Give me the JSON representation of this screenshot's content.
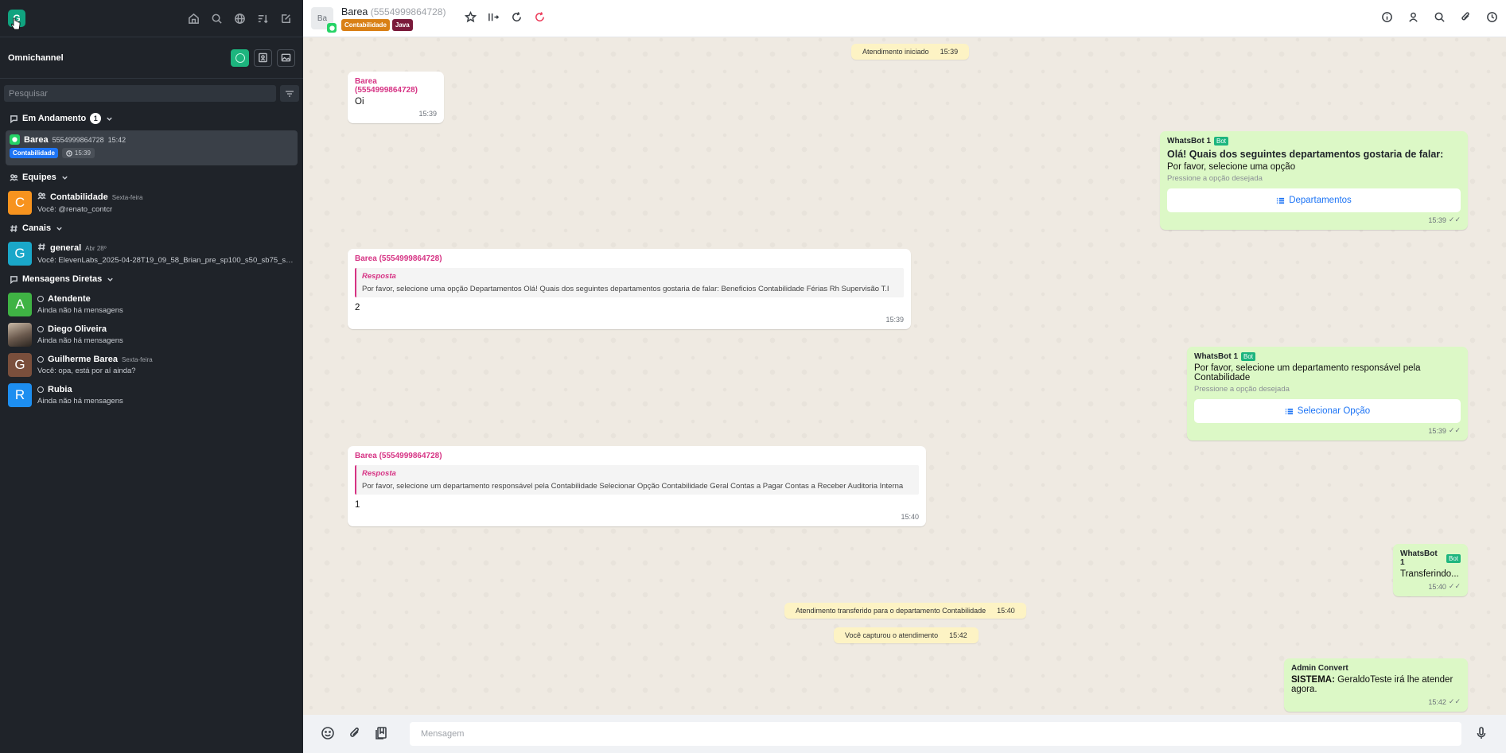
{
  "sidebar": {
    "me_initial": "G",
    "omnichannel_title": "Omnichannel",
    "search_placeholder": "Pesquisar",
    "in_progress": {
      "label": "Em Andamento",
      "count": "1",
      "conversation": {
        "name": "Barea",
        "phone": "5554999864728",
        "time": "15:42",
        "tag": "Contabilidade",
        "wait_time": "15:39"
      }
    },
    "teams": {
      "label": "Equipes",
      "items": [
        {
          "initial": "C",
          "color": "#f7931e",
          "name": "Contabilidade",
          "date": "Sexta-feira",
          "last": "Você: @renato_contcr"
        }
      ]
    },
    "channels": {
      "label": "Canais",
      "items": [
        {
          "initial": "G",
          "color": "#1aa7c9",
          "name": "general",
          "date": "Abr 28º",
          "last": "Você: ElevenLabs_2025-04-28T19_09_58_Brian_pre_sp100_s50_sb75_se..."
        }
      ]
    },
    "direct": {
      "label": "Mensagens Diretas",
      "items": [
        {
          "initial": "A",
          "color": "#3fb344",
          "name": "Atendente",
          "date": "",
          "last": "Ainda não há mensagens"
        },
        {
          "initial": "",
          "color": "",
          "name": "Diego Oliveira",
          "date": "",
          "last": "Ainda não há mensagens"
        },
        {
          "initial": "G",
          "color": "#7a4f3c",
          "name": "Guilherme Barea",
          "date": "Sexta-feira",
          "last": "Você: opa, está por aí ainda?"
        },
        {
          "initial": "R",
          "color": "#1d8ef0",
          "name": "Rubia",
          "date": "",
          "last": "Ainda não há mensagens"
        }
      ]
    }
  },
  "header": {
    "avatar_text": "Ba",
    "name": "Barea",
    "phone": "(5554999864728)",
    "tags": [
      {
        "label": "Contabilidade",
        "color": "#d98016"
      },
      {
        "label": "Java",
        "color": "#7a1a3a"
      }
    ]
  },
  "messages": {
    "sys_start": {
      "text": "Atendimento iniciado",
      "time": "15:39"
    },
    "m1": {
      "author": "Barea (5554999864728)",
      "text": "Oi",
      "time": "15:39"
    },
    "m2": {
      "author": "WhatsBot 1",
      "badge": "Bot",
      "title": "Olá! Quais dos seguintes departamentos gostaria de falar:",
      "text": "Por favor, selecione uma opção",
      "hint": "Pressione a opção desejada",
      "button": "Departamentos",
      "time": "15:39"
    },
    "m3": {
      "author": "Barea (5554999864728)",
      "quote_title": "Resposta",
      "quote_text": "Por favor, selecione uma opção Departamentos Olá! Quais dos seguintes departamentos gostaria de falar: Beneficios Contabilidade Férias Rh Supervisão T.I",
      "text": "2",
      "time": "15:39"
    },
    "m4": {
      "author": "WhatsBot 1",
      "badge": "Bot",
      "text": "Por favor, selecione um departamento responsável pela Contabilidade",
      "hint": "Pressione a opção desejada",
      "button": "Selecionar Opção",
      "time": "15:39"
    },
    "m5": {
      "author": "Barea (5554999864728)",
      "quote_title": "Resposta",
      "quote_text": "Por favor, selecione um departamento responsável pela Contabilidade Selecionar Opção Contabilidade Geral Contas a Pagar Contas a Receber Auditoria Interna",
      "text": "1",
      "time": "15:40"
    },
    "m6": {
      "author": "WhatsBot 1",
      "badge": "Bot",
      "text": "Transferindo...",
      "time": "15:40"
    },
    "sys_transfer": {
      "text": "Atendimento transferido para o departamento Contabilidade",
      "time": "15:40"
    },
    "sys_capture": {
      "text": "Você capturou o atendimento",
      "time": "15:42"
    },
    "m7": {
      "author": "Admin Convert",
      "label": "SISTEMA:",
      "text": "GeraldoTeste irá lhe atender agora.",
      "time": "15:42"
    }
  },
  "composer": {
    "placeholder": "Mensagem"
  }
}
